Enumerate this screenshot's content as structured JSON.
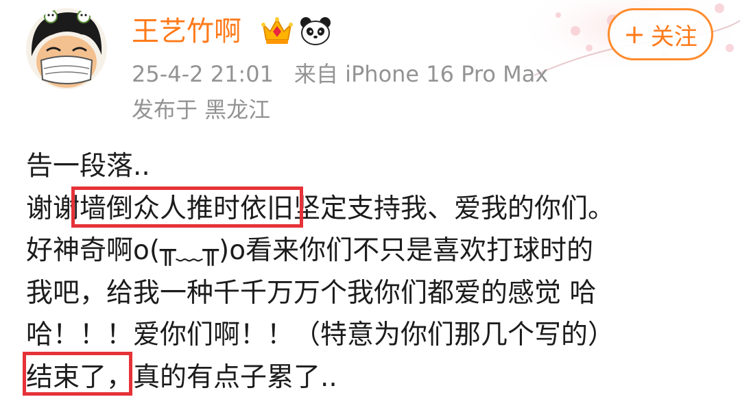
{
  "post": {
    "author": {
      "name": "王艺竹啊"
    },
    "follow_label": "关注",
    "timestamp": "25-4-2 21:01",
    "source": "来自 iPhone 16 Pro Max",
    "location": "发布于 黑龙江",
    "body_lines": [
      "告一段落..",
      "谢谢墙倒众人推时依旧坚定支持我、爱我的你们。",
      "好神奇啊o(╥﹏╥)o看来你们不只是喜欢打球时的",
      "我吧，给我一种千千万万个我你们都爱的感觉 哈",
      "哈！！！爱你们啊！！（特意为你们那几个写的）",
      "结束了，真的有点子累了.."
    ]
  },
  "colors": {
    "username": "#ff7a1a",
    "meta_text": "#939393",
    "body_text": "#1c1c1c",
    "highlight": "#e53238",
    "follow_border": "#ff8a2a"
  },
  "icons": [
    "vip-crown-icon",
    "panda-icon",
    "plus-icon"
  ]
}
